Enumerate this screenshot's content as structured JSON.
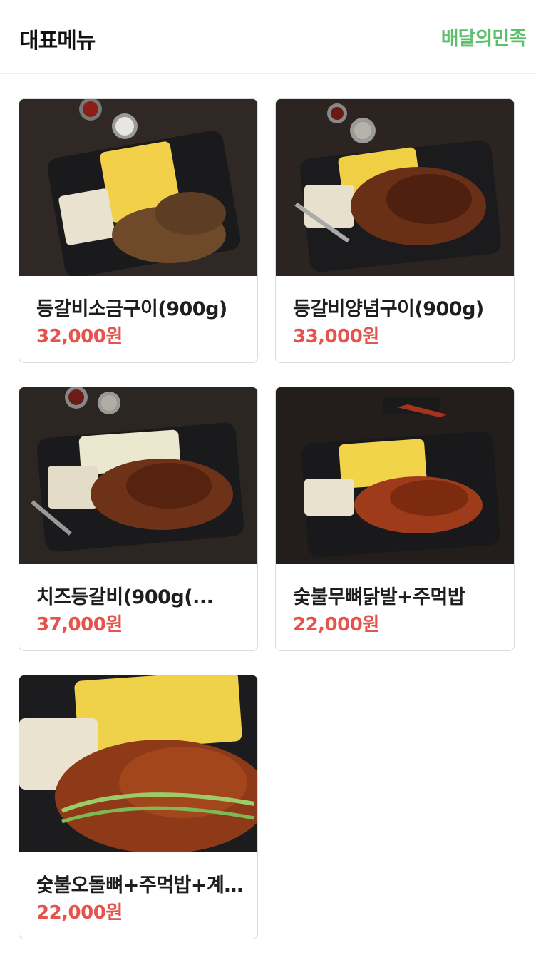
{
  "header": {
    "title": "대표메뉴",
    "brand": "배달의민족"
  },
  "colors": {
    "brand_green": "#5bbf6b",
    "price_red": "#e5534b"
  },
  "menu": [
    {
      "name": "등갈비소금구이(900g)",
      "price": "32,000원",
      "photo": "grill-salt-ribs"
    },
    {
      "name": "등갈비양념구이(900g)",
      "price": "33,000원",
      "photo": "grill-sauce-ribs"
    },
    {
      "name": "치즈등갈비(900g(...",
      "price": "37,000원",
      "photo": "cheese-ribs"
    },
    {
      "name": "숯불무뼈닭발+주먹밥",
      "price": "22,000원",
      "photo": "chicken-feet"
    },
    {
      "name": "숯불오돌뼈+주먹밥+계란찜",
      "price": "22,000원",
      "photo": "cartilage"
    }
  ]
}
